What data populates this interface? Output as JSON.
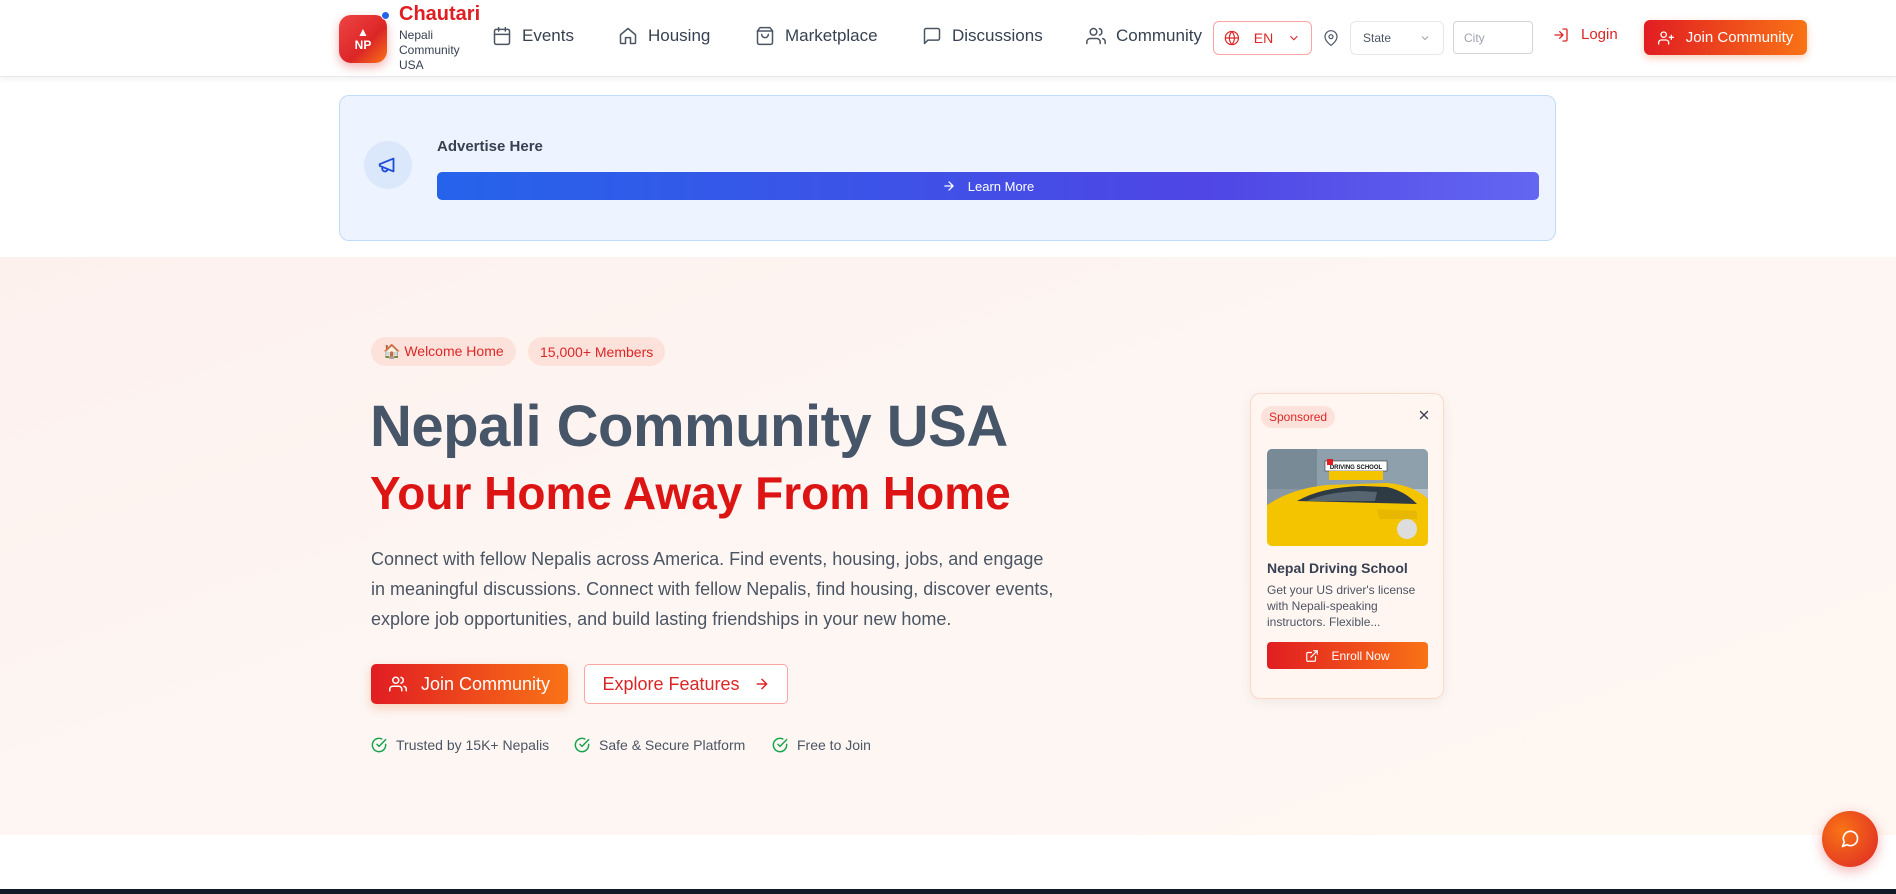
{
  "header": {
    "logo_text": "NP",
    "brand_title": "Chautari",
    "brand_subtitle": "Nepali Community USA",
    "nav": [
      {
        "label": "Events",
        "icon": "calendar-icon"
      },
      {
        "label": "Housing",
        "icon": "home-icon"
      },
      {
        "label": "Marketplace",
        "icon": "shopping-bag-icon"
      },
      {
        "label": "Discussions",
        "icon": "message-square-icon"
      },
      {
        "label": "Community",
        "icon": "users-icon"
      }
    ],
    "language": "EN",
    "state_placeholder": "State",
    "city_placeholder": "City",
    "login_label": "Login",
    "join_label": "Join Community"
  },
  "ad_banner": {
    "title": "Advertise Here",
    "button_label": "Learn More"
  },
  "hero": {
    "badges": [
      "🏠 Welcome Home",
      "15,000+ Members"
    ],
    "title": "Nepali Community USA",
    "subtitle": "Your Home Away From Home",
    "description": "Connect with fellow Nepalis across America. Find events, housing, jobs, and engage in meaningful discussions. Connect with fellow Nepalis, find housing, discover events, explore job opportunities, and build lasting friendships in your new home.",
    "join_label": "Join Community",
    "explore_label": "Explore Features",
    "trust_items": [
      "Trusted by 15K+ Nepalis",
      "Safe & Secure Platform",
      "Free to Join"
    ]
  },
  "sponsored": {
    "tag": "Sponsored",
    "name": "Nepal Driving School",
    "description": "Get your US driver's license with Nepali-speaking instructors. Flexible...",
    "button_label": "Enroll Now",
    "image_sign": "DRIVING SCHOOL"
  },
  "colors": {
    "brand_red": "#dc2626",
    "brand_orange": "#f97316",
    "ad_blue": "#2563eb",
    "title_slate": "#475569"
  }
}
